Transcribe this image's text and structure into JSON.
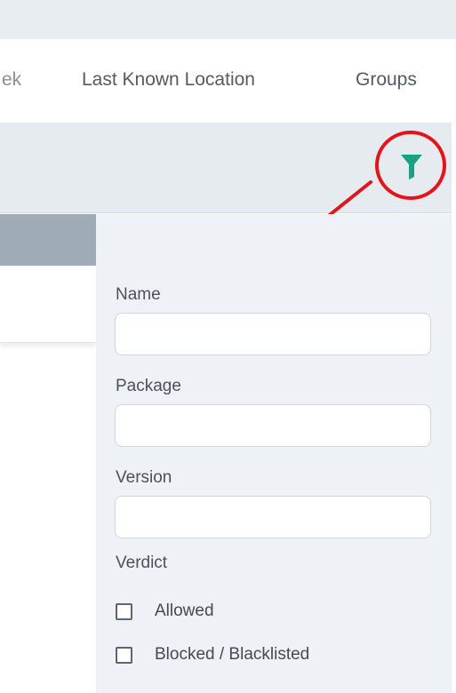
{
  "header": {
    "tabs": [
      {
        "label": "ek"
      },
      {
        "label": "Last Known Location"
      },
      {
        "label": "Groups"
      }
    ]
  },
  "toolbar": {
    "filter_icon": "filter-funnel-icon",
    "filter_icon_color": "#1aa084"
  },
  "annotation": {
    "highlight_color": "#e3141b"
  },
  "filter_panel": {
    "fields": [
      {
        "label": "Name",
        "value": "",
        "placeholder": ""
      },
      {
        "label": "Package",
        "value": "",
        "placeholder": ""
      },
      {
        "label": "Version",
        "value": "",
        "placeholder": ""
      }
    ],
    "verdict": {
      "label": "Verdict",
      "options": [
        {
          "label": "Allowed",
          "checked": false
        },
        {
          "label": "Blocked / Blacklisted",
          "checked": false
        }
      ]
    }
  }
}
